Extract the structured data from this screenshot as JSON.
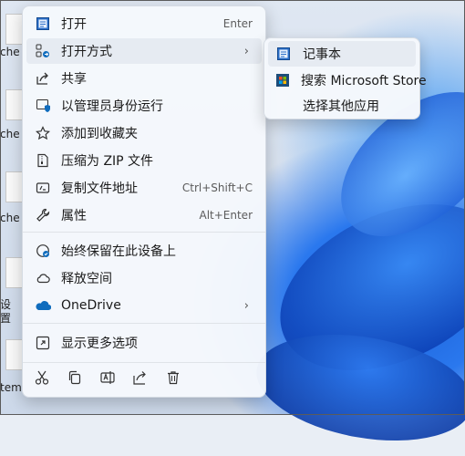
{
  "desktop": {
    "left_labels": [
      "che",
      "che",
      "che",
      "设",
      "置",
      "tem"
    ]
  },
  "menu": {
    "items": [
      {
        "label": "打开",
        "shortcut": "Enter",
        "icon": "notepad-icon"
      },
      {
        "label": "打开方式",
        "icon": "open-with-icon",
        "has_submenu": true
      },
      {
        "label": "共享",
        "icon": "share-icon"
      },
      {
        "label": "以管理员身份运行",
        "icon": "shield-icon"
      },
      {
        "label": "添加到收藏夹",
        "icon": "star-icon"
      },
      {
        "label": "压缩为 ZIP 文件",
        "icon": "zip-icon"
      },
      {
        "label": "复制文件地址",
        "shortcut": "Ctrl+Shift+C",
        "icon": "copy-path-icon"
      },
      {
        "label": "属性",
        "shortcut": "Alt+Enter",
        "icon": "wrench-icon"
      },
      {
        "label": "始终保留在此设备上",
        "icon": "cloud-sync-icon"
      },
      {
        "label": "释放空间",
        "icon": "cloud-icon"
      },
      {
        "label": "OneDrive",
        "icon": "onedrive-icon",
        "has_submenu": true
      },
      {
        "label": "显示更多选项",
        "icon": "more-options-icon"
      }
    ],
    "toolbar": [
      "cut-icon",
      "copy-icon",
      "rename-icon",
      "share-icon",
      "delete-icon"
    ]
  },
  "submenu": {
    "items": [
      {
        "label": "记事本",
        "icon": "notepad-icon"
      },
      {
        "label": "搜索 Microsoft Store",
        "icon": "store-icon"
      },
      {
        "label": "选择其他应用",
        "icon": ""
      }
    ]
  },
  "colors": {
    "accent": "#0f6cbd",
    "menu_bg": "#f5f8fc",
    "hover_bg": "#e6ebf2"
  }
}
